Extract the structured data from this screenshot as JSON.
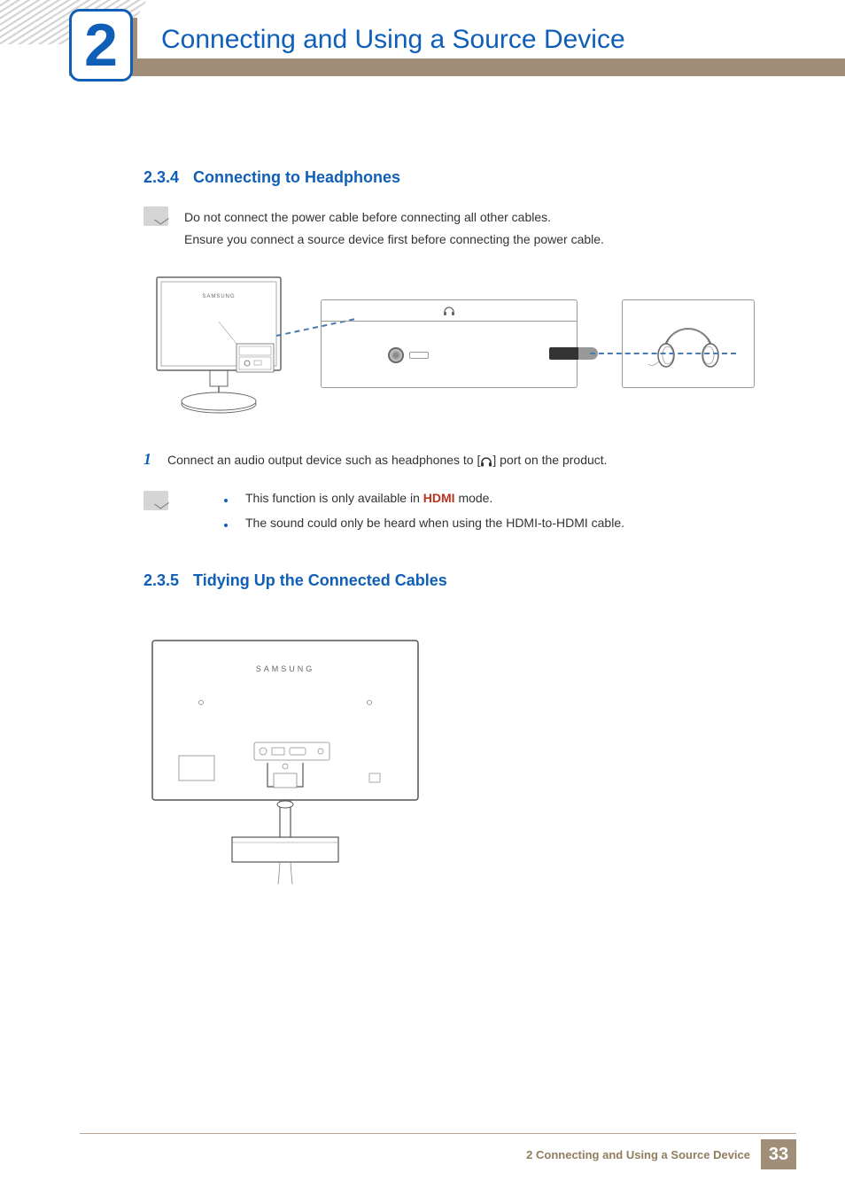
{
  "chapter": {
    "number": "2",
    "title": "Connecting and Using a Source Device"
  },
  "sections": {
    "s234": {
      "number": "2.3.4",
      "title": "Connecting to Headphones",
      "note_line1": "Do not connect the power cable before connecting all other cables.",
      "note_line2": "Ensure you connect a source device first before connecting the power cable.",
      "step1_number": "1",
      "step1_text_before": "Connect an audio output device such as headphones to [",
      "step1_text_after": "] port on the product.",
      "bullet1_before": "This function is only available in ",
      "bullet1_hdmi": "HDMI",
      "bullet1_after": " mode.",
      "bullet2": "The sound could only be heard when using the HDMI-to-HDMI cable."
    },
    "s235": {
      "number": "2.3.5",
      "title": "Tidying Up the Connected Cables"
    }
  },
  "footer": {
    "text": "2 Connecting and Using a Source Device",
    "page": "33"
  },
  "brand": "SAMSUNG"
}
